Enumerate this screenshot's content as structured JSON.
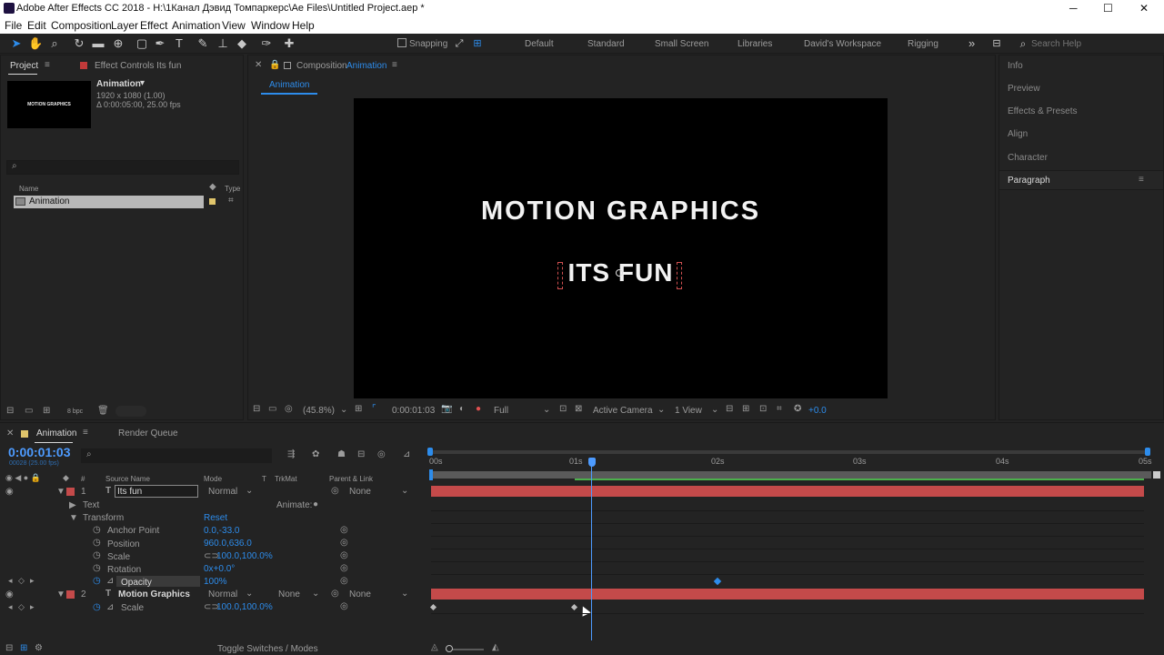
{
  "titlebar": {
    "title": "Adobe After Effects CC 2018 - H:\\1Канал Дэвид Томпаркерс\\Ae Files\\Untitled Project.aep *",
    "minimize": "─",
    "maximize": "☐",
    "close": "✕"
  },
  "menu": [
    "File",
    "Edit",
    "Composition",
    "Layer",
    "Effect",
    "Animation",
    "View",
    "Window",
    "Help"
  ],
  "toolbar": {
    "snapping": "Snapping",
    "workspaces": [
      "Default",
      "Standard",
      "Small Screen",
      "Libraries",
      "David's Workspace",
      "Rigging"
    ],
    "more": "»",
    "search_placeholder": "Search Help"
  },
  "project": {
    "tab_project": "Project",
    "tab_effect_controls": "Effect Controls Its fun",
    "comp_name": "Animation",
    "comp_size": "1920 x 1080 (1.00)",
    "comp_duration": "Δ 0:00:05:00, 25.00 fps",
    "thumb_text": "MOTION GRAPHICS",
    "col_name": "Name",
    "col_type": "Type",
    "item_name": "Animation",
    "bpc": "8 bpc"
  },
  "comp": {
    "tab_prefix": "Composition",
    "tab_name": "Animation",
    "subtab": "Animation",
    "line1": "MOTION GRAPHICS",
    "line2": "ITS FUN",
    "zoom": "(45.8%)",
    "time": "0:00:01:03",
    "resolution": "Full",
    "camera": "Active Camera",
    "view": "1 View",
    "exposure": "+0.0"
  },
  "right": {
    "sections": [
      "Info",
      "Preview",
      "Effects & Presets",
      "Align",
      "Character",
      "Paragraph"
    ]
  },
  "timeline": {
    "tab_comp": "Animation",
    "tab_render": "Render Queue",
    "timecode": "0:00:01:03",
    "frames": "00028 (25.00 fps)",
    "col_source": "Source Name",
    "col_mode": "Mode",
    "col_t": "T",
    "col_trkmat": "TrkMat",
    "col_parent": "Parent & Link",
    "ruler": [
      "00s",
      "01s",
      "02s",
      "03s",
      "04s",
      "05s"
    ],
    "toggle": "Toggle Switches / Modes"
  },
  "layer1": {
    "num": "1",
    "name": "Its fun",
    "mode": "Normal",
    "parent": "None",
    "text": "Text",
    "animate": "Animate:",
    "transform": "Transform",
    "reset": "Reset",
    "props": [
      {
        "name": "Anchor Point",
        "value": "0.0,-33.0"
      },
      {
        "name": "Position",
        "value": "960.0,636.0"
      },
      {
        "name": "Scale",
        "value": "100.0,100.0%"
      },
      {
        "name": "Rotation",
        "value": "0x+0.0°"
      },
      {
        "name": "Opacity",
        "value": "100%"
      }
    ]
  },
  "layer2": {
    "num": "2",
    "name": "Motion Graphics",
    "mode": "Normal",
    "trkmat": "None",
    "parent": "None",
    "scale_label": "Scale",
    "scale_value": "100.0,100.0%"
  },
  "colors": {
    "accent": "#2d8ceb",
    "layer_red": "#c44a4a",
    "work_green": "#4cb04c"
  }
}
